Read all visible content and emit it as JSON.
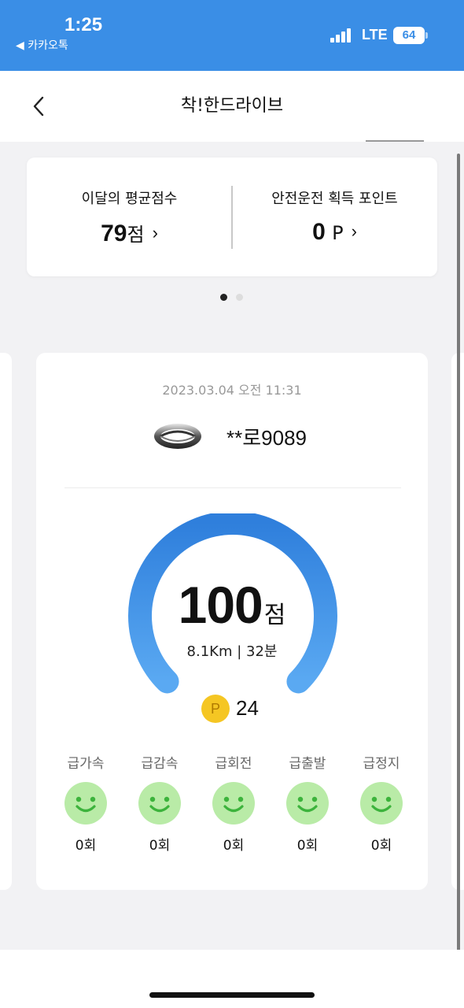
{
  "status_bar": {
    "time": "1:25",
    "back_app": "◀ 카카오톡",
    "network": "LTE",
    "battery": "64"
  },
  "nav": {
    "title": "착!한드라이브",
    "back_icon": "chevron-left-icon"
  },
  "summary": {
    "avg_score_label": "이달의 평균점수",
    "avg_score_value": "79",
    "avg_score_unit": "점",
    "points_label": "안전운전 획득 포인트",
    "points_value": "0",
    "points_unit": "P",
    "chevron": "›"
  },
  "pagination": {
    "count": 2,
    "active": 0
  },
  "trip": {
    "datetime": "2023.03.04 오전 11:31",
    "car_logo_icon": "car-brand-logo-icon",
    "plate": "**로9089",
    "score": "100",
    "score_unit": "점",
    "gauge_level": 1.0,
    "distance_duration": "8.1Km | 32분",
    "points_badge": "P",
    "points_earned": "24",
    "events": [
      {
        "label": "급가속",
        "count": "0회",
        "icon": "smiley-face-icon"
      },
      {
        "label": "급감속",
        "count": "0회",
        "icon": "smiley-face-icon"
      },
      {
        "label": "급회전",
        "count": "0회",
        "icon": "smiley-face-icon"
      },
      {
        "label": "급출발",
        "count": "0회",
        "icon": "smiley-face-icon"
      },
      {
        "label": "급정지",
        "count": "0회",
        "icon": "smiley-face-icon"
      }
    ]
  },
  "colors": {
    "status_bar": "#3a8ee6",
    "gauge_top": "#2f7fdc",
    "gauge_bottom": "#5aa9f2",
    "point_badge": "#f5c623",
    "face_bg": "#b9eba7",
    "face_features": "#3cb33c"
  }
}
